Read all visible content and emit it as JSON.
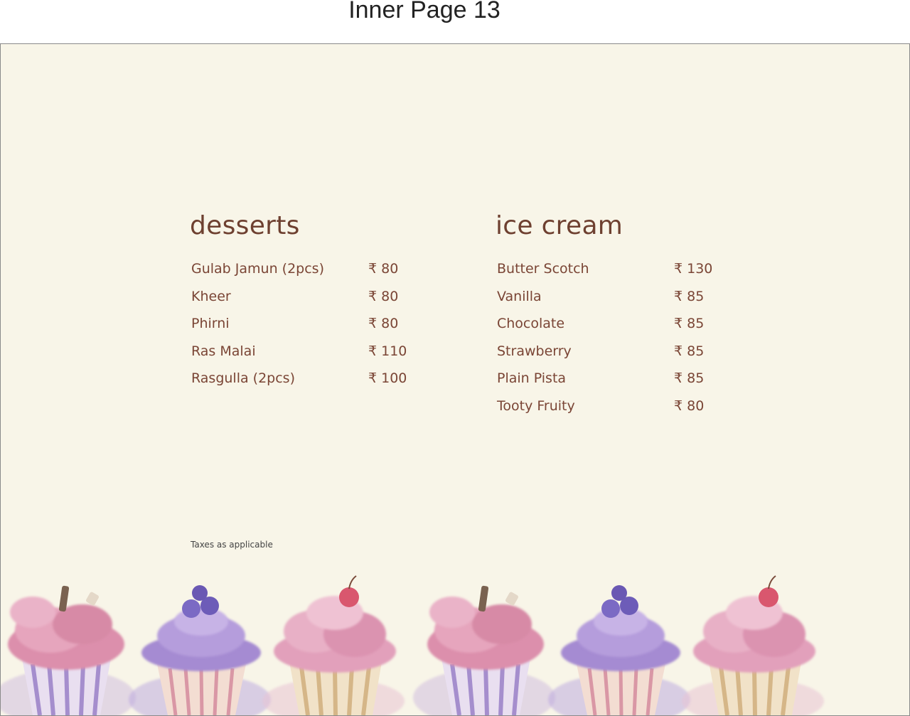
{
  "page_label": "Inner Page 13",
  "desserts": {
    "title": "desserts",
    "items": [
      {
        "name": "Gulab Jamun (2pcs)",
        "price": "₹ 80"
      },
      {
        "name": "Kheer",
        "price": "₹ 80"
      },
      {
        "name": "Phirni",
        "price": "₹ 80"
      },
      {
        "name": "Ras Malai",
        "price": "₹ 110"
      },
      {
        "name": "Rasgulla (2pcs)",
        "price": "₹ 100"
      }
    ]
  },
  "ice_cream": {
    "title": "ice cream",
    "items": [
      {
        "name": "Butter Scotch",
        "price": "₹ 130"
      },
      {
        "name": "Vanilla",
        "price": "₹ 85"
      },
      {
        "name": "Chocolate",
        "price": "₹ 85"
      },
      {
        "name": "Strawberry",
        "price": "₹ 85"
      },
      {
        "name": "Plain Pista",
        "price": "₹ 85"
      },
      {
        "name": "Tooty Fruity",
        "price": "₹ 80"
      }
    ]
  },
  "tax_note": "Taxes as applicable",
  "colors": {
    "background": "#f8f5e8",
    "text_brown": "#7a4535",
    "pink_frosting": "#d98aa8",
    "purple_frosting": "#9b84c9"
  },
  "decoration": {
    "icon": "watercolor-cupcake-icon"
  }
}
